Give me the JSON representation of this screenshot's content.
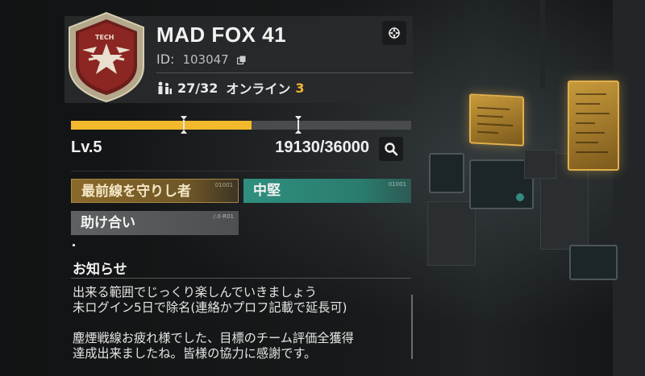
{
  "profile": {
    "emblem_text": "TECH",
    "name": "MAD FOX 41",
    "id_label": "ID:",
    "id_value": "103047",
    "members": "27/32",
    "online_label": "オンライン",
    "online_count": "3"
  },
  "level": {
    "label": "Lv.5",
    "xp_text": "19130/36000",
    "progress_fraction": 0.53
  },
  "titles": [
    {
      "label": "最前線を守りし者",
      "code": "01001",
      "style": "gold"
    },
    {
      "label": "中堅",
      "code": "01001",
      "style": "teal"
    },
    {
      "label": "助け合い",
      "code": "/.0-R01",
      "style": "grey"
    }
  ],
  "notice": {
    "title": "お知らせ",
    "body": "出来る範囲でじっくり楽しんでいきましょう\n未ログイン5日で除名(連絡かプロフ記載で延長可)\n\n塵煙戦線お疲れ様でした、目標のチーム評価全獲得\n達成出来ましたね。皆様の協力に感謝です。"
  },
  "colors": {
    "accent_gold": "#f2b92c",
    "online_orange": "#f2b530",
    "title_teal": "#2f8f7e"
  },
  "icons": [
    "members-icon",
    "copy-icon",
    "compass-icon",
    "search-icon",
    "emblem-icon"
  ]
}
